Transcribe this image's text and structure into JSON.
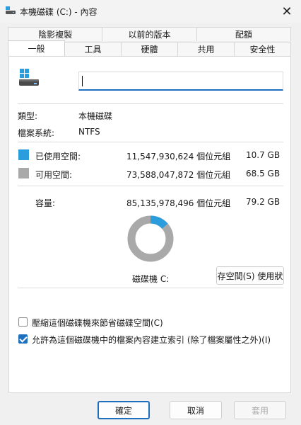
{
  "window": {
    "title": "本機磁碟 (C:) - 內容",
    "close_glyph": "✕"
  },
  "tabs": {
    "row1": [
      "陰影複製",
      "以前的版本",
      "配額"
    ],
    "row2": [
      "一般",
      "工具",
      "硬體",
      "共用",
      "安全性"
    ],
    "active": "一般"
  },
  "general": {
    "name_value": "",
    "type_label": "類型:",
    "type_value": "本機磁碟",
    "fs_label": "檔案系統:",
    "fs_value": "NTFS",
    "used_label": "已使用空間:",
    "used_bytes": "11,547,930,624 個位元組",
    "used_size": "10.7 GB",
    "used_color": "#2b9cdc",
    "free_label": "可用空間:",
    "free_bytes": "73,588,047,872 個位元組",
    "free_size": "68.5 GB",
    "free_color": "#a9a9a9",
    "capacity_label": "容量:",
    "capacity_bytes": "85,135,978,496 個位元組",
    "capacity_size": "79.2 GB",
    "used_fraction": 0.1356,
    "drive_label": "磁碟機 C:",
    "cleanup_button": "存空間(S) 使用狀",
    "compress_checkbox": {
      "label": "壓縮這個磁碟機來節省磁碟空間(C)",
      "checked": false
    },
    "index_checkbox": {
      "label": "允許為這個磁碟機中的檔案內容建立索引 (除了檔案屬性之外)(I)",
      "checked": true
    }
  },
  "footer": {
    "ok": "確定",
    "cancel": "取消",
    "apply": "套用"
  },
  "icons": {
    "title": "drive-icon",
    "windows_logo": "windows-logo-icon",
    "drive": "hard-drive-icon"
  }
}
